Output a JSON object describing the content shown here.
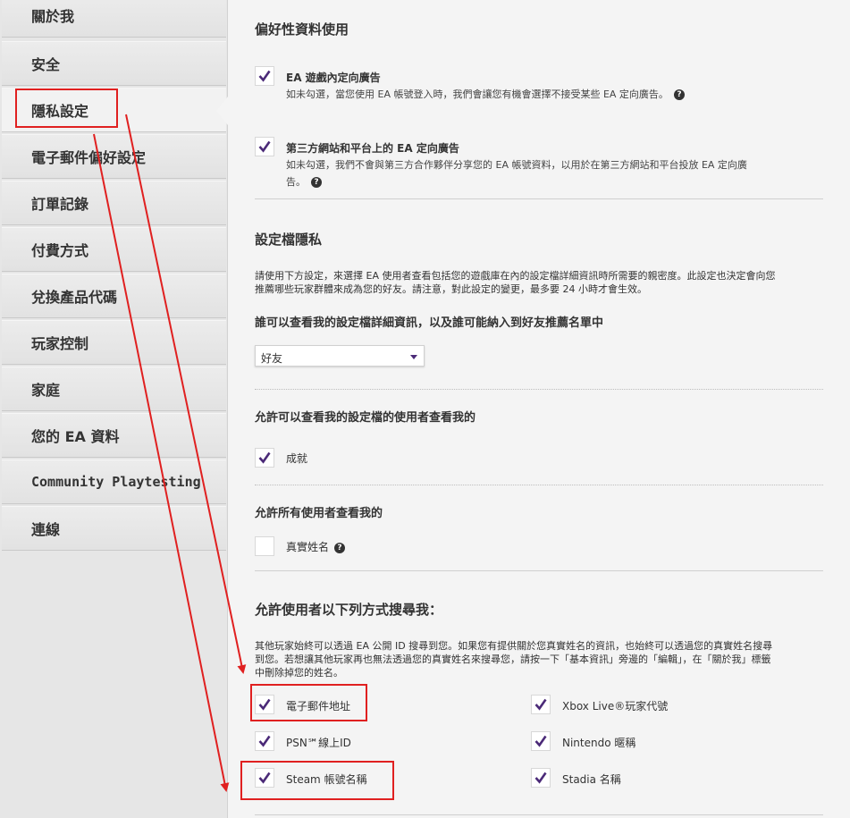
{
  "sidebar": {
    "items": [
      {
        "label": "關於我"
      },
      {
        "label": "安全"
      },
      {
        "label": "隱私設定"
      },
      {
        "label": "電子郵件偏好設定"
      },
      {
        "label": "訂單記錄"
      },
      {
        "label": "付費方式"
      },
      {
        "label": "兌換產品代碼"
      },
      {
        "label": "玩家控制"
      },
      {
        "label": "家庭"
      },
      {
        "label": "您的 EA 資料"
      },
      {
        "label": "Community Playtesting"
      },
      {
        "label": "連線"
      }
    ],
    "active_index": 2
  },
  "preferences": {
    "heading": "偏好性資料使用",
    "ingame_ads": {
      "title": "EA 遊戲內定向廣告",
      "desc": "如未勾選，當您使用 EA 帳號登入時，我們會讓您有機會選擇不接受某些 EA 定向廣告。",
      "checked": true
    },
    "thirdparty_ads": {
      "title": "第三方網站和平台上的 EA 定向廣告",
      "desc1": "如未勾選，我們不會與第三方合作夥伴分享您的 EA 帳號資料，以用於在第三方網站和平台投放 EA 定向廣",
      "desc2": "告。",
      "checked": true
    }
  },
  "profile_privacy": {
    "heading": "設定檔隱私",
    "desc1": "請使用下方設定，來選擇 EA 使用者查看包括您的遊戲庫在內的設定檔詳細資訊時所需要的親密度。此設定也決定會向您",
    "desc2": "推薦哪些玩家群體來成為您的好友。請注意，對此設定的變更，最多要 24 小時才會生效。",
    "who_label": "誰可以查看我的設定檔詳細資訊，以及誰可能納入到好友推薦名單中",
    "who_value": "好友",
    "viewers_label": "允許可以查看我的設定檔的使用者查看我的",
    "achievements": {
      "label": "成就",
      "checked": true
    },
    "all_users_label": "允許所有使用者查看我的",
    "real_name": {
      "label": "真實姓名",
      "checked": false
    }
  },
  "search": {
    "heading": "允許使用者以下列方式搜尋我：",
    "desc1": "其他玩家始終可以透過 EA 公開 ID 搜尋到您。如果您有提供關於您真實姓名的資訊，也始終可以透過您的真實姓名搜尋",
    "desc2": "到您。若想讓其他玩家再也無法透過您的真實姓名來搜尋您，請按一下「基本資訊」旁邊的「編輯」，在「關於我」標籤",
    "desc3": "中刪除掉您的姓名。",
    "options": [
      {
        "label": "電子郵件地址",
        "checked": true
      },
      {
        "label": "Xbox Live®玩家代號",
        "checked": true
      },
      {
        "label": "PSN℠線上ID",
        "checked": true
      },
      {
        "label": "Nintendo 暱稱",
        "checked": true
      },
      {
        "label": "Steam 帳號名稱",
        "checked": true
      },
      {
        "label": "Stadia 名稱",
        "checked": true
      }
    ]
  },
  "colors": {
    "check": "#4b2a78",
    "annotation": "#e02020"
  },
  "icons": {
    "checkbox_mark": "checkmark-icon",
    "help": "question-circle-icon",
    "dropdown": "caret-down-icon"
  }
}
